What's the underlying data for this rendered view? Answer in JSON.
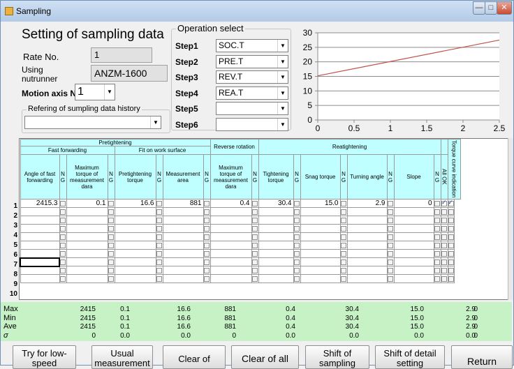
{
  "window": {
    "title": "Sampling",
    "min": "—",
    "max": "□",
    "close": "✕"
  },
  "header": {
    "title": "Setting of sampling data"
  },
  "rate": {
    "label": "Rate No.",
    "value": "1"
  },
  "nutrunner": {
    "label_line1": "Using",
    "label_line2": "nutrunner",
    "value": "ANZM-1600"
  },
  "motion": {
    "label": "Motion axis No.",
    "value": "1"
  },
  "history": {
    "legend": "Refering of sumpling data history",
    "value": ""
  },
  "operation": {
    "legend": "Operation select",
    "steps": [
      {
        "label": "Step1",
        "value": "SOC.T"
      },
      {
        "label": "Step2",
        "value": "PRE.T"
      },
      {
        "label": "Step3",
        "value": "REV.T"
      },
      {
        "label": "Step4",
        "value": "REA.T"
      },
      {
        "label": "Step5",
        "value": ""
      },
      {
        "label": "Step6",
        "value": ""
      }
    ]
  },
  "chart_data": {
    "type": "line",
    "title": "",
    "xlabel": "",
    "ylabel": "",
    "xlim": [
      0,
      2.5
    ],
    "ylim": [
      0,
      30
    ],
    "xticks": [
      "0",
      "0.5",
      "1",
      "1.5",
      "2",
      "2.5"
    ],
    "yticks": [
      "0",
      "5",
      "10",
      "15",
      "20",
      "25",
      "30"
    ],
    "grid": true,
    "series": [
      {
        "x": [
          0,
          2.5
        ],
        "y": [
          15.2,
          27.5
        ],
        "color": "#c0504d"
      }
    ]
  },
  "grid": {
    "groups": {
      "pretightening": "Pretightening",
      "fast_forwarding": "Fast forwarding",
      "fit_on_work_surface": "Fit on work surface",
      "reverse_rotation": "Reverse rotation",
      "reatightening": "Reatightening"
    },
    "columns": {
      "angle_fast": "Angle of fast forwarding",
      "max_torque": "Maximum torque of measurement dara",
      "pretight_torque": "Pretightening torque",
      "meas_area": "Measurement area",
      "rev_max_torque": "Maximum torque of measurement dara",
      "tight_torque": "Tightening torque",
      "snag_torque": "Snag torque",
      "turning_angle": "Turning angle",
      "slope": "Slope",
      "ng": "N G",
      "all_ok": "All OK",
      "torque_curve": "Torque curve indication"
    },
    "rows": [
      {
        "no": "1",
        "angle": "2415.3",
        "max": "0.1",
        "pre": "16.6",
        "area": "881",
        "rev": "0.4",
        "tight": "30.4",
        "snag": "15.0",
        "turn": "2.9",
        "slope": "0"
      },
      {
        "no": "2"
      },
      {
        "no": "3"
      },
      {
        "no": "4"
      },
      {
        "no": "5"
      },
      {
        "no": "6"
      },
      {
        "no": "7"
      },
      {
        "no": "8"
      },
      {
        "no": "9"
      },
      {
        "no": "10"
      }
    ]
  },
  "stats": {
    "labels": [
      "Max",
      "Min",
      "Ave",
      "σ"
    ],
    "rows": [
      [
        "2415",
        "0.1",
        "16.6",
        "881",
        "0.4",
        "30.4",
        "15.0",
        "2.9",
        "0"
      ],
      [
        "2415",
        "0.1",
        "16.6",
        "881",
        "0.4",
        "30.4",
        "15.0",
        "2.9",
        "0"
      ],
      [
        "2415",
        "0.1",
        "16.6",
        "881",
        "0.4",
        "30.4",
        "15.0",
        "2.9",
        "0"
      ],
      [
        "0",
        "0.0",
        "0.0",
        "0",
        "0.0",
        "0.0",
        "0.0",
        "0.0",
        "0"
      ]
    ]
  },
  "buttons": {
    "try_low_speed": "Try for low-speed",
    "usual_measurement": "Usual measurement",
    "clear_of": "Clear of",
    "clear_of_all": "Clear of all",
    "shift_sampling": "Shift of sampling",
    "shift_detail": "Shift of detail setting",
    "return": "Return"
  }
}
